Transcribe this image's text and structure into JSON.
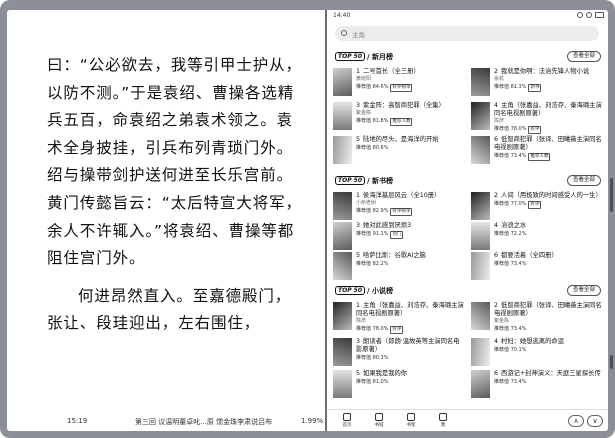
{
  "reader": {
    "paragraphs": [
      "曰：“公必欲去，我等引甲士护从，以防不测。”于是袁绍、曹操各选精兵五百，命袁绍之弟袁术领之。袁术全身披挂，引兵布列青琐门外。绍与操带剑护送何进至长乐宫前。黄门传懿旨云：“太后特宣大将军，余人不许辄入。”将袁绍、曹操等都阻住宫门外。",
      "何进昂然直入。至嘉德殿门，张让、段珪迎出，左右围住，"
    ],
    "footer": {
      "time": "15:19",
      "chapter": "第三回 议温明董卓叱...原 馈金珠李肃说吕布",
      "percent": "1.99%"
    }
  },
  "status": {
    "clock": "14:40"
  },
  "search": {
    "placeholder": "主角"
  },
  "view_all": "查看全部",
  "sections": [
    {
      "logo": "TOP 50",
      "name": "/ 新月榜",
      "items": [
        {
          "rank": "1",
          "title": "二号首长（全三册）",
          "author": "黄晓阳",
          "rec": "推荐值 84.6%",
          "tag": "好评榜单"
        },
        {
          "rank": "2",
          "title": "我就是你啊：法治先锋人物小说",
          "author": "余杭",
          "rec": "推荐值 81.3%",
          "tag": "新书"
        },
        {
          "rank": "3",
          "title": "紫金阵：高智商犯罪（全集）",
          "author": "紫金陈",
          "rec": "推荐值 81.8%",
          "tag": "推荐人数"
        },
        {
          "rank": "4",
          "title": "主角（张嘉益、刘浩存、秦海璐主演同名电视剧原著）",
          "author": "陈彦",
          "rec": "推荐值 78.0%",
          "tag": "好评"
        },
        {
          "rank": "5",
          "title": "陆地的尽头，是海洋的开始",
          "author": "",
          "rec": "推荐值 80.6%",
          "tag": ""
        },
        {
          "rank": "6",
          "title": "低智商犯罪（张译、田曦薇主演同名电视剧原著）",
          "author": "",
          "rec": "推荐值 73.4%",
          "tag": "推荐人数"
        }
      ]
    },
    {
      "logo": "TOP 50",
      "name": "/ 新书榜",
      "items": [
        {
          "rank": "1",
          "title": "侯海洋基层风云（全10册）",
          "author": "小桥老树",
          "rec": "推荐值 82.9%",
          "tag": "好评榜单"
        },
        {
          "rank": "2",
          "title": "人间（用极致的时间感受人的一生）",
          "author": "",
          "rec": "推荐值 77.0%",
          "tag": "好评"
        },
        {
          "rank": "3",
          "title": "她对此感到厌烦3",
          "author": "",
          "rec": "推荐值 91.1%",
          "tag": "热门"
        },
        {
          "rank": "4",
          "title": "冶浪之水",
          "author": "",
          "rec": "推荐值 72.2%",
          "tag": ""
        },
        {
          "rank": "5",
          "title": "哈萨比斯：谷歌AI之脑",
          "author": "",
          "rec": "推荐值 82.2%",
          "tag": ""
        },
        {
          "rank": "6",
          "title": "都要活着（全四册）",
          "author": "",
          "rec": "推荐值 73.4%",
          "tag": ""
        }
      ]
    },
    {
      "logo": "TOP 50",
      "name": "/ 小说榜",
      "items": [
        {
          "rank": "1",
          "title": "主角（张嘉益、刘浩存、秦海璐主演同名电视剧原著）",
          "author": "陈彦",
          "rec": "推荐值 78.0%",
          "tag": "好评"
        },
        {
          "rank": "2",
          "title": "低智商犯罪（张译、田曦薇主演同名电视剧原著）",
          "author": "紫金陈",
          "rec": "推荐值 73.4%",
          "tag": ""
        },
        {
          "rank": "3",
          "title": "朗读者（郎朗·温故英等主演同名电影原著）",
          "author": "",
          "rec": "推荐值 80.3%",
          "tag": ""
        },
        {
          "rank": "4",
          "title": "村妇：她想逃离的命运",
          "author": "",
          "rec": "推荐值 70.1%",
          "tag": ""
        },
        {
          "rank": "5",
          "title": "如果我是我的你",
          "author": "",
          "rec": "推荐值 81.0%",
          "tag": ""
        },
        {
          "rank": "6",
          "title": "西游记+封神演义：天庭三星探长传",
          "author": "",
          "rec": "推荐值 73.4%",
          "tag": ""
        }
      ]
    }
  ],
  "nav": [
    {
      "label": "首页"
    },
    {
      "label": "书城"
    },
    {
      "label": "书架"
    },
    {
      "label": "我"
    }
  ],
  "pager": {
    "up": "∧",
    "down": "∨"
  }
}
